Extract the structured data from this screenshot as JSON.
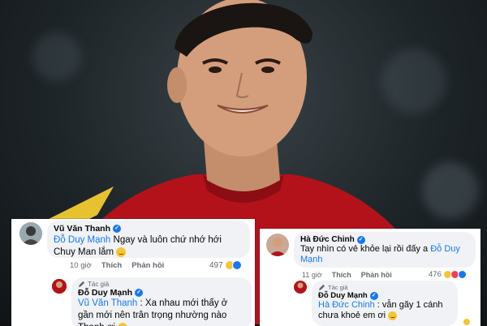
{
  "left_card": {
    "comment": {
      "author": "Vũ Văn Thanh",
      "mention": "Đỗ Duy Mạnh",
      "text": "Ngay và luôn chứ nhớ hới Chuy Man lắm",
      "time": "10 giờ",
      "like_label": "Thích",
      "reply_label": "Phản hồi",
      "reaction_count": "497"
    },
    "reply": {
      "author_tag": "Tác giả",
      "author": "Đỗ Duy Mạnh",
      "mention": "Vũ Văn Thanh",
      "text": ": Xa nhau mới thấy ở gần mới nên trân trọng nhường nào Thanh ơi"
    }
  },
  "right_card": {
    "comment": {
      "author": "Hà Đức Chinh",
      "text": "Tay nhìn có vẻ khỏe lại rồi đấy a",
      "mention": "Đỗ Duy Mạnh",
      "time": "11 giờ",
      "like_label": "Thích",
      "reply_label": "Phản hồi",
      "reaction_count": "476"
    },
    "reply": {
      "author_tag": "Tác giả",
      "author": "Đỗ Duy Mạnh",
      "mention": "Hà Đức Chinh",
      "text": ": vẫn gãy 1 cánh chưa khoẻ em ơi"
    }
  },
  "colors": {
    "link": "#1877f2",
    "bubble": "#f0f2f5",
    "meta": "#65676b",
    "jersey": "#b3121a"
  }
}
